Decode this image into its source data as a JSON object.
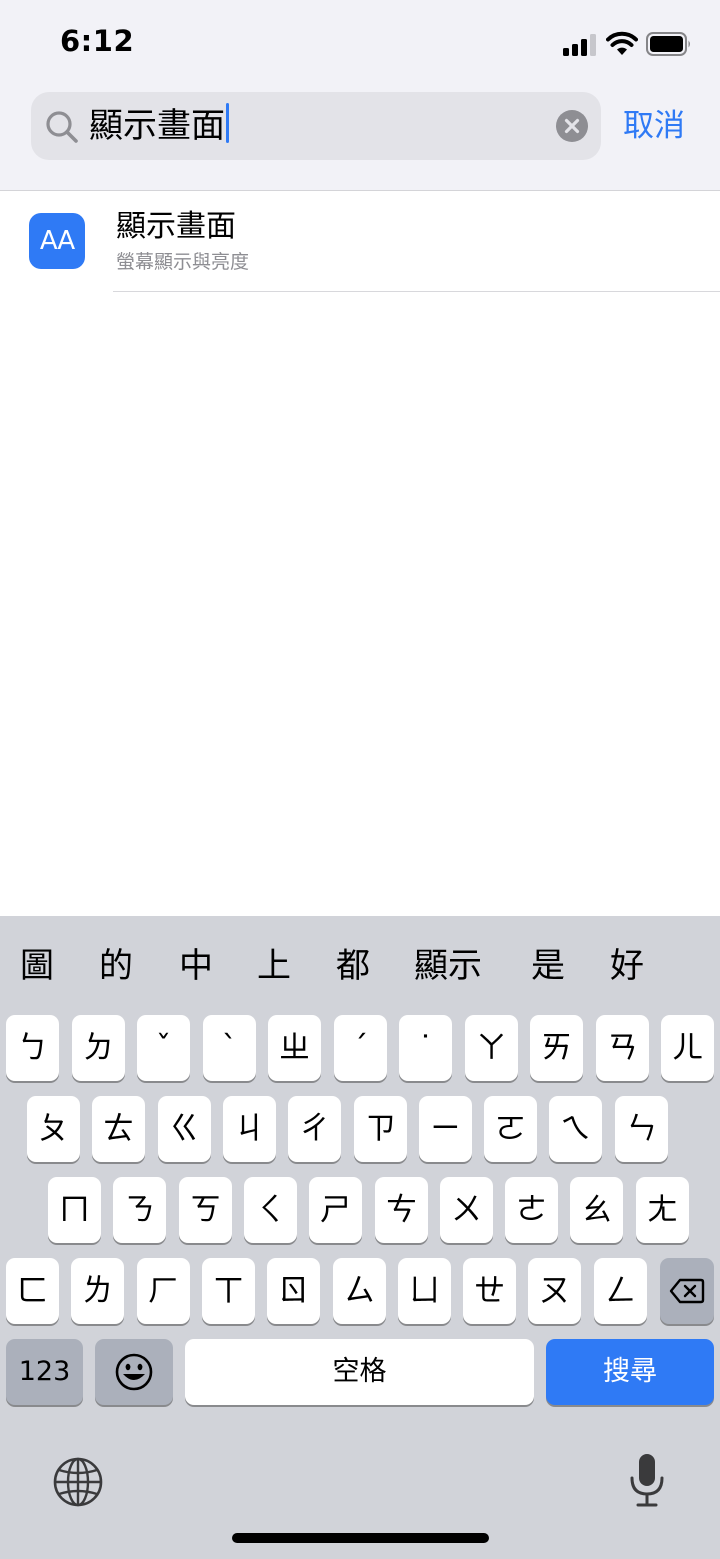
{
  "status": {
    "time": "6:12"
  },
  "search": {
    "query": "顯示畫面",
    "cancel_label": "取消"
  },
  "results": [
    {
      "icon_text": "AA",
      "title": "顯示畫面",
      "subtitle": "螢幕顯示與亮度"
    }
  ],
  "keyboard": {
    "candidates": [
      "圖",
      "的",
      "中",
      "上",
      "都",
      "顯示",
      "是",
      "好"
    ],
    "rows": [
      [
        "ㄅ",
        "ㄉ",
        "ˇ",
        "ˋ",
        "ㄓ",
        "ˊ",
        "˙",
        "ㄚ",
        "ㄞ",
        "ㄢ",
        "ㄦ"
      ],
      [
        "ㄆ",
        "ㄊ",
        "ㄍ",
        "ㄐ",
        "ㄔ",
        "ㄗ",
        "ㄧ",
        "ㄛ",
        "ㄟ",
        "ㄣ"
      ],
      [
        "ㄇ",
        "ㄋ",
        "ㄎ",
        "ㄑ",
        "ㄕ",
        "ㄘ",
        "ㄨ",
        "ㄜ",
        "ㄠ",
        "ㄤ"
      ],
      [
        "ㄈ",
        "ㄌ",
        "ㄏ",
        "ㄒ",
        "ㄖ",
        "ㄙ",
        "ㄩ",
        "ㄝ",
        "ㄡ",
        "ㄥ"
      ]
    ],
    "numbers_label": "123",
    "space_label": "空格",
    "search_label": "搜尋"
  },
  "colors": {
    "accent": "#2f7af5",
    "keyboard_bg": "#d1d3d9",
    "function_key": "#abb0bb"
  }
}
